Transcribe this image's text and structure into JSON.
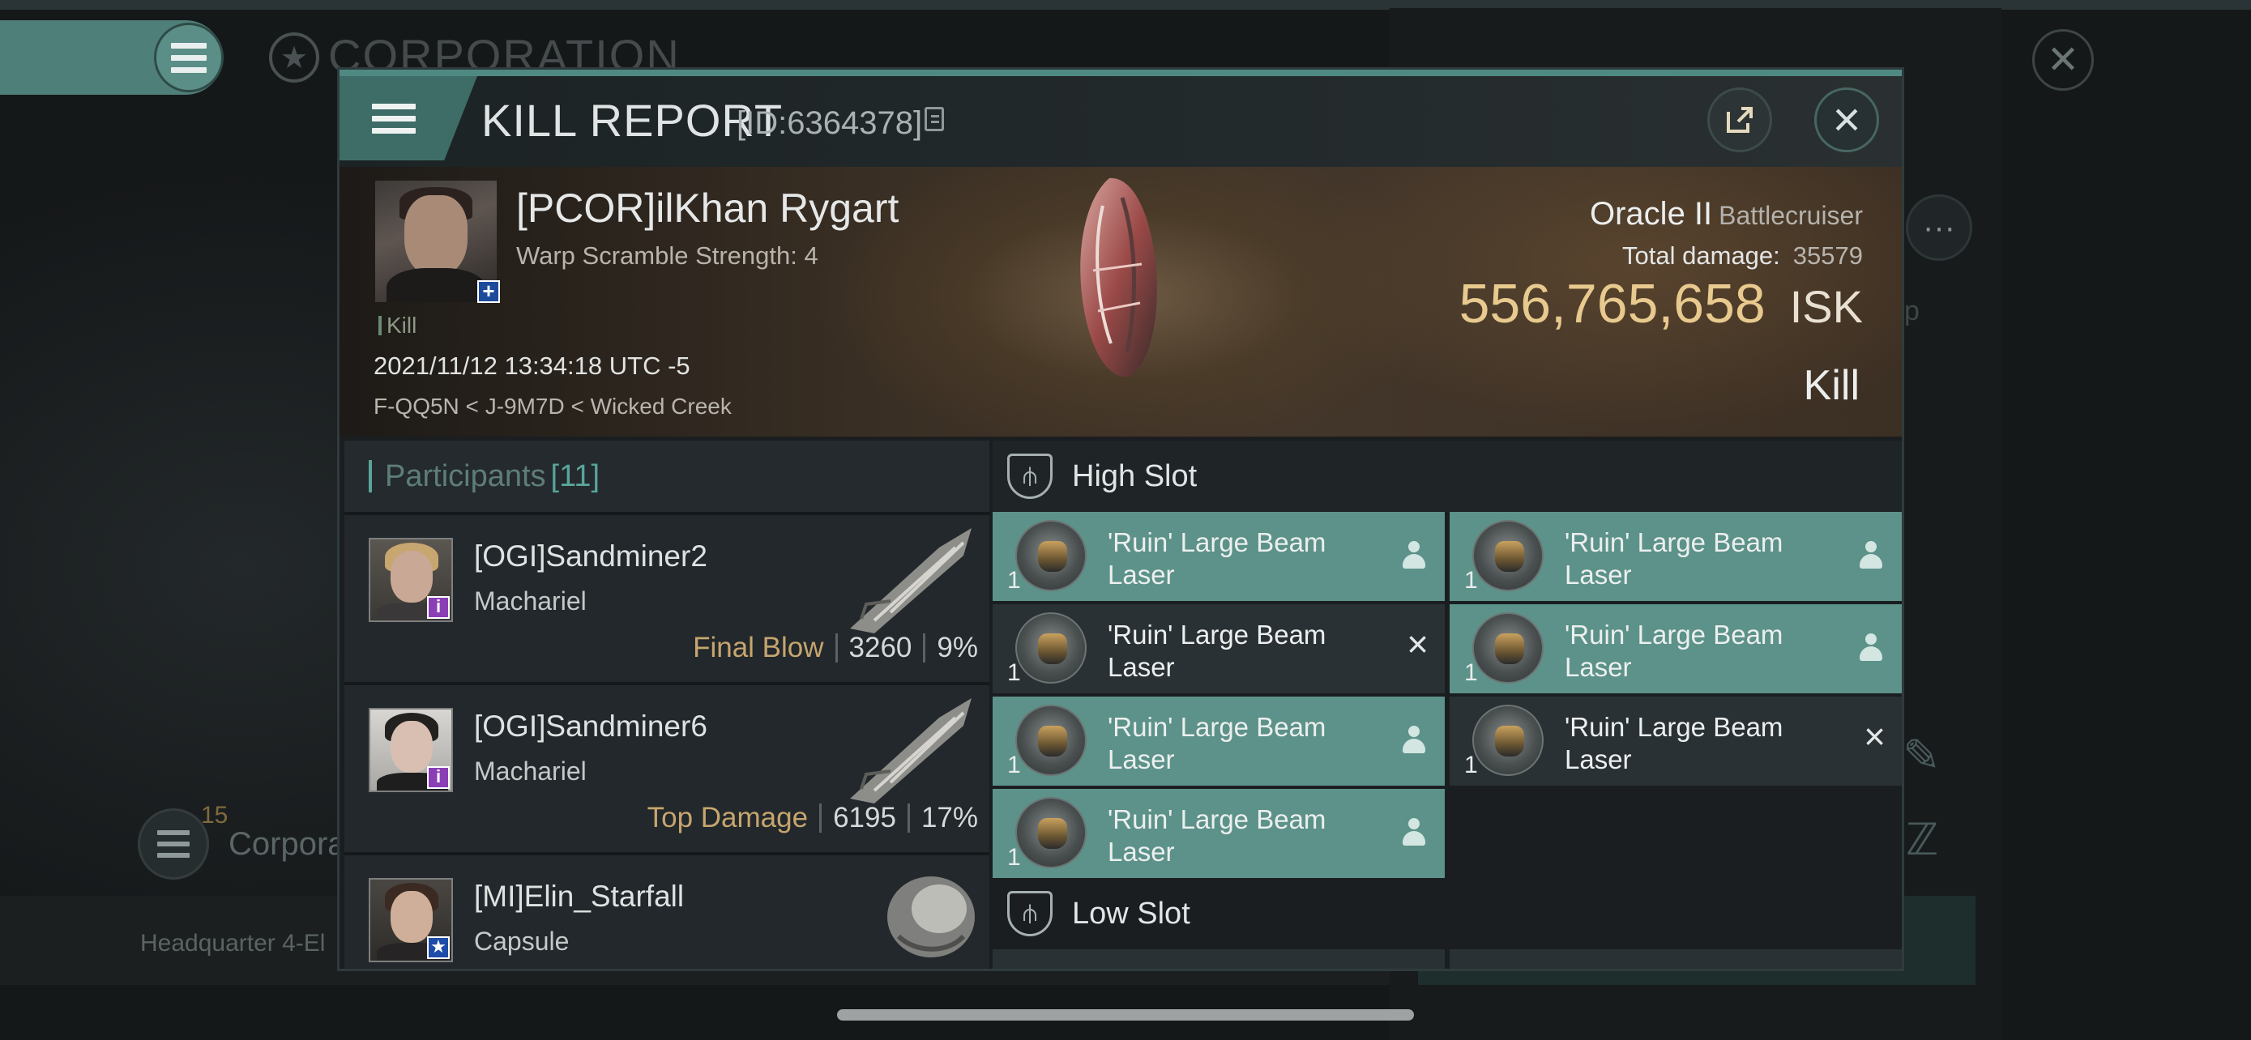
{
  "background": {
    "corp_title": "CORPORATION",
    "corp_count": "15",
    "corp_label": "Corpora",
    "side_letter": "p",
    "headquarter": "Headquarter 4-El"
  },
  "modal": {
    "title": "KILL REPORT",
    "report_id": "[ID:6364378]"
  },
  "victim": {
    "name": "[PCOR]ilKhan Rygart",
    "warp_scramble": "Warp Scramble Strength: 4",
    "kill_tag": "Kill",
    "time": "2021/11/12 13:34:18 UTC -5",
    "location": "F-QQ5N < J-9M7D < Wicked Creek",
    "ship_name": "Oracle II",
    "ship_class": "Battlecruiser",
    "total_damage_label": "Total damage:",
    "total_damage": "35579",
    "isk_value": "556,765,658",
    "isk_unit": "ISK",
    "kill_type": "Kill"
  },
  "participants": {
    "title": "Participants",
    "count": "[11]",
    "rows": [
      {
        "name": "[OGI]Sandminer2",
        "ship": "Machariel",
        "tag": "Final Blow",
        "damage": "3260",
        "percent": "9%"
      },
      {
        "name": "[OGI]Sandminer6",
        "ship": "Machariel",
        "tag": "Top Damage",
        "damage": "6195",
        "percent": "17%"
      },
      {
        "name": "[MI]Elin_Starfall",
        "ship": "Capsule",
        "tag": "",
        "damage": "",
        "percent": ""
      }
    ]
  },
  "fitting": {
    "high_slot_title": "High Slot",
    "low_slot_title": "Low Slot",
    "high_modules": [
      {
        "name": "'Ruin' Large Beam Laser",
        "qty": "1",
        "state": "fitted"
      },
      {
        "name": "'Ruin' Large Beam Laser",
        "qty": "1",
        "state": "fitted"
      },
      {
        "name": "'Ruin' Large Beam Laser",
        "qty": "1",
        "state": "destroyed"
      },
      {
        "name": "'Ruin' Large Beam Laser",
        "qty": "1",
        "state": "fitted"
      },
      {
        "name": "'Ruin' Large Beam Laser",
        "qty": "1",
        "state": "fitted"
      },
      {
        "name": "'Ruin' Large Beam Laser",
        "qty": "1",
        "state": "destroyed"
      },
      {
        "name": "'Ruin' Large Beam Laser",
        "qty": "1",
        "state": "fitted"
      }
    ]
  },
  "colors": {
    "accent_teal": "#5c9289",
    "isk_gold": "#e8c98e",
    "tag_gold": "#c7a56e"
  },
  "icons": [
    "hamburger-icon",
    "star-icon",
    "close-icon",
    "share-icon",
    "copy-icon",
    "more-icon",
    "edit-icon",
    "settings-icon",
    "high-slot-icon",
    "low-slot-icon",
    "person-icon",
    "x-icon"
  ]
}
